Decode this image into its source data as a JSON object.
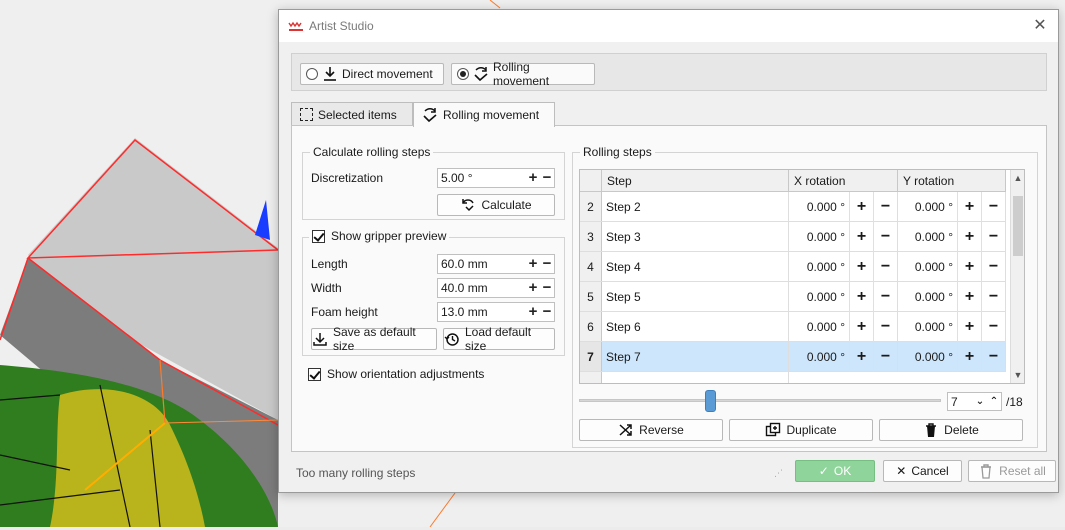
{
  "window": {
    "title": "Artist Studio"
  },
  "modes": [
    {
      "label": "Direct movement",
      "selected": false,
      "icon": "direct-movement-icon"
    },
    {
      "label": "Rolling movement",
      "selected": true,
      "icon": "rolling-movement-icon"
    }
  ],
  "tabs": [
    {
      "label": "Selected items",
      "icon": "selection-box-icon",
      "active": false
    },
    {
      "label": "Rolling movement",
      "icon": "rolling-movement-icon",
      "active": true
    }
  ],
  "calc": {
    "title": "Calculate rolling steps",
    "discretization_label": "Discretization",
    "discretization_value": "5.00 °",
    "calculate_label": "Calculate"
  },
  "gripper": {
    "show_label": "Show gripper preview",
    "checked": true,
    "length_label": "Length",
    "length_value": "60.0 mm",
    "width_label": "Width",
    "width_value": "40.0 mm",
    "foam_label": "Foam height",
    "foam_value": "13.0 mm",
    "save_label": "Save as default size",
    "load_label": "Load default size"
  },
  "orientation": {
    "label": "Show orientation adjustments",
    "checked": true
  },
  "steps": {
    "title": "Rolling steps",
    "columns": [
      "Step",
      "X rotation",
      "Y rotation"
    ],
    "rows": [
      {
        "num": "2",
        "step": "Step 2",
        "x": "0.000 °",
        "y": "0.000 °",
        "selected": false
      },
      {
        "num": "3",
        "step": "Step 3",
        "x": "0.000 °",
        "y": "0.000 °",
        "selected": false
      },
      {
        "num": "4",
        "step": "Step 4",
        "x": "0.000 °",
        "y": "0.000 °",
        "selected": false
      },
      {
        "num": "5",
        "step": "Step 5",
        "x": "0.000 °",
        "y": "0.000 °",
        "selected": false
      },
      {
        "num": "6",
        "step": "Step 6",
        "x": "0.000 °",
        "y": "0.000 °",
        "selected": false
      },
      {
        "num": "7",
        "step": "Step 7",
        "x": "0.000 °",
        "y": "0.000 °",
        "selected": true
      }
    ],
    "plus": "+",
    "minus": "−",
    "current": "7",
    "total": "/18",
    "slider_fraction": 0.36,
    "reverse_label": "Reverse",
    "duplicate_label": "Duplicate",
    "delete_label": "Delete"
  },
  "footer": {
    "status": "Too many rolling steps",
    "ok_label": "OK",
    "cancel_label": "Cancel",
    "reset_label": "Reset all"
  },
  "colors": {
    "accent": "#5b9bd5",
    "ok": "#8fd49a",
    "selected_row": "#cde6fb"
  }
}
